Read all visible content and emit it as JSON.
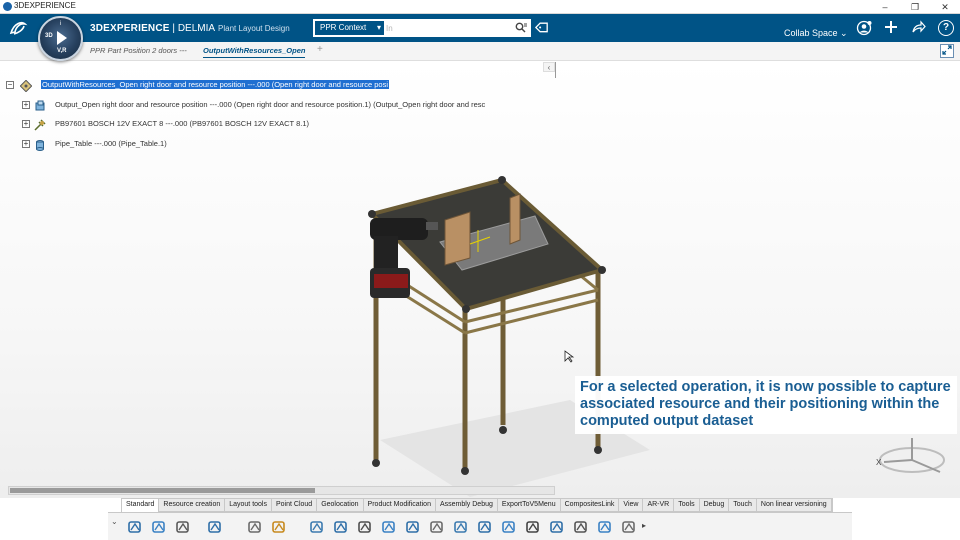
{
  "window": {
    "title": "3DEXPERIENCE",
    "min": "–",
    "restore": "❐",
    "close": "✕"
  },
  "topbar": {
    "brand_bold": "3DEXPERIENCE",
    "brand_sep": " | ",
    "brand_product": "DELMIA",
    "brand_app": "Plant Layout Design",
    "compass": {
      "top": "i",
      "left": "3D",
      "bottom": "V,R"
    },
    "search_context": "PPR Context",
    "search_placeholder": "In",
    "collab_space": "Collab Space ⌄",
    "colors": {
      "bar": "#005386",
      "accent": "#1a5e93"
    }
  },
  "tabs": [
    {
      "label": "PPR Part Position 2 doors ---",
      "active": false
    },
    {
      "label": "OutputWithResources_Open",
      "active": true
    }
  ],
  "tree": {
    "nodes": [
      {
        "label": "OutputWithResources_Open right door and resource position ---.000 (Open right door and resource posi",
        "icon": "process-icon",
        "selected": true
      },
      {
        "label": "Output_Open right door and resource position ---.000 (Open right door and resource position.1) (Output_Open right door and resc",
        "icon": "product-icon",
        "selected": false
      },
      {
        "label": "PB97601 BOSCH 12V EXACT 8 ---.000 (PB97601 BOSCH 12V EXACT 8.1)",
        "icon": "tool-resource-icon",
        "selected": false
      },
      {
        "label": "Pipe_Table ---.000 (Pipe_Table.1)",
        "icon": "part-icon",
        "selected": false
      }
    ]
  },
  "caption": "For a selected operation, it is now possible to capture associated resource and their positioning within the computed output dataset",
  "compass_axis": "X",
  "action_tabs": [
    {
      "label": "Standard",
      "active": true
    },
    {
      "label": "Resource creation",
      "active": false
    },
    {
      "label": "Layout tools",
      "active": false
    },
    {
      "label": "Point Cloud",
      "active": false
    },
    {
      "label": "Geolocation",
      "active": false
    },
    {
      "label": "Product Modification",
      "active": false
    },
    {
      "label": "Assembly Debug",
      "active": false
    },
    {
      "label": "ExportToV5Menu",
      "active": false
    },
    {
      "label": "CompositesLink",
      "active": false
    },
    {
      "label": "View",
      "active": false
    },
    {
      "label": "AR-VR",
      "active": false
    },
    {
      "label": "Tools",
      "active": false
    },
    {
      "label": "Debug",
      "active": false
    },
    {
      "label": "Touch",
      "active": false
    },
    {
      "label": "Non linear versioning",
      "active": false
    }
  ],
  "toolbar_icons": [
    "cut-icon",
    "copy-icon",
    "paste-icon",
    "undo-icon",
    "measure-icon",
    "update-icon",
    "robot-icon",
    "pipe-icon",
    "fastener-icon",
    "grid-layout-icon",
    "conveyor-icon",
    "anchor-icon",
    "machine-icon",
    "resource-icon",
    "table-icon",
    "text-icon",
    "axis-icon",
    "compass-icon",
    "scale-icon",
    "export-icon"
  ]
}
